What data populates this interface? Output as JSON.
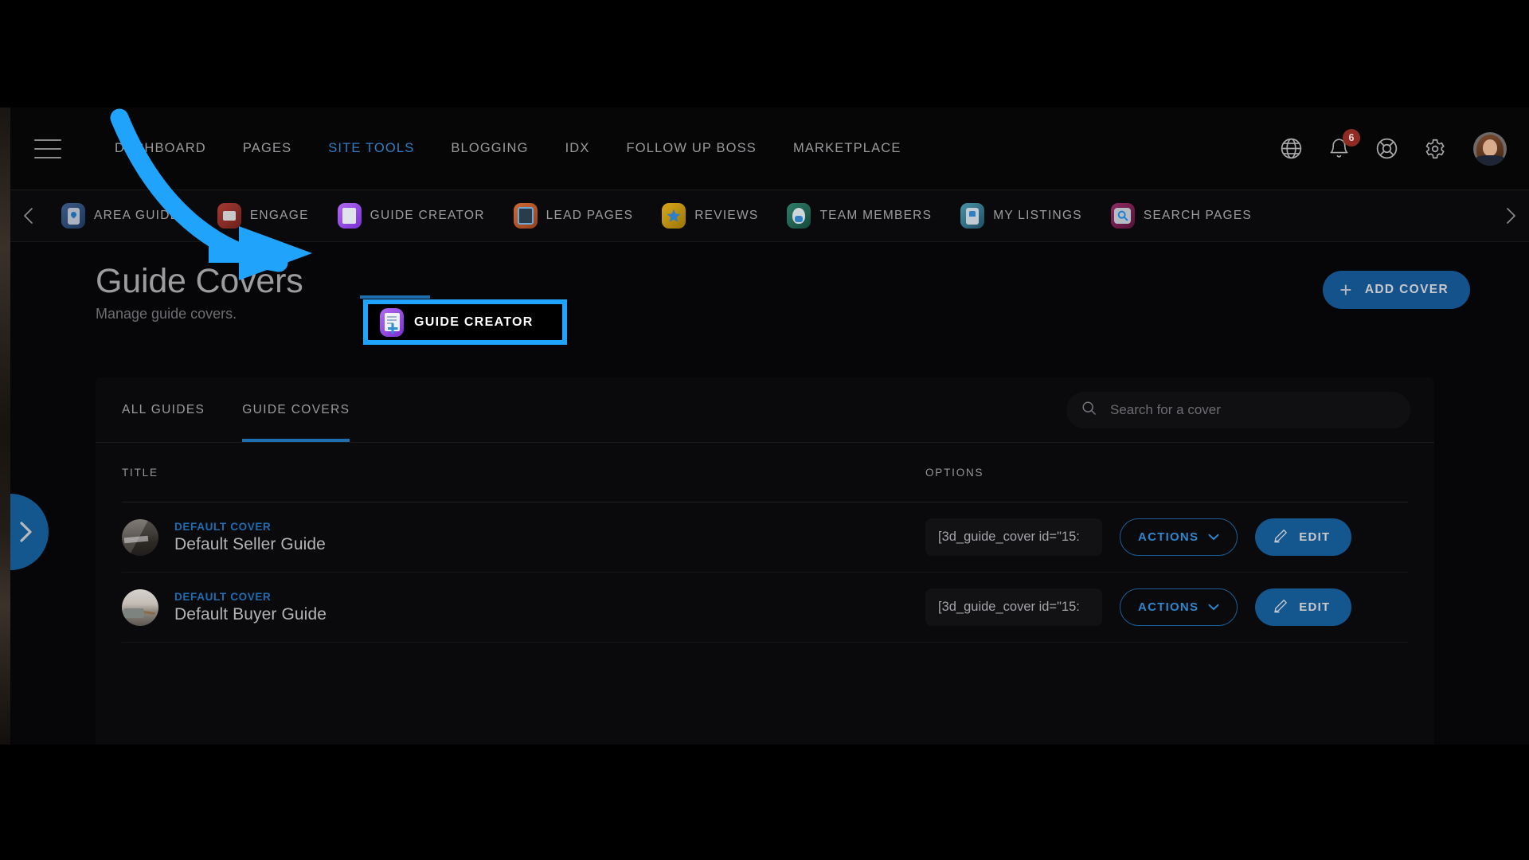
{
  "topnav": {
    "menu_icon": "hamburger-icon",
    "items": [
      {
        "label": "DASHBOARD",
        "active": false
      },
      {
        "label": "PAGES",
        "active": false
      },
      {
        "label": "SITE TOOLS",
        "active": true
      },
      {
        "label": "BLOGGING",
        "active": false
      },
      {
        "label": "IDX",
        "active": false
      },
      {
        "label": "FOLLOW UP BOSS",
        "active": false
      },
      {
        "label": "MARKETPLACE",
        "active": false
      }
    ],
    "icons": [
      {
        "name": "globe-icon"
      },
      {
        "name": "bell-icon",
        "badge": "6"
      },
      {
        "name": "lifebuoy-help-icon"
      },
      {
        "name": "gear-settings-icon"
      },
      {
        "name": "user-avatar"
      }
    ]
  },
  "subnav": {
    "prev_icon": "chevron-left-icon",
    "next_icon": "chevron-right-icon",
    "tabs": [
      {
        "label": "AREA GUIDES",
        "icon": "area-guides-icon",
        "active": false
      },
      {
        "label": "ENGAGE",
        "icon": "engage-icon",
        "active": false
      },
      {
        "label": "GUIDE CREATOR",
        "icon": "guide-creator-icon",
        "active": true
      },
      {
        "label": "LEAD PAGES",
        "icon": "lead-pages-icon",
        "active": false
      },
      {
        "label": "REVIEWS",
        "icon": "reviews-icon",
        "active": false
      },
      {
        "label": "TEAM MEMBERS",
        "icon": "team-members-icon",
        "active": false
      },
      {
        "label": "MY LISTINGS",
        "icon": "my-listings-icon",
        "active": false
      },
      {
        "label": "SEARCH PAGES",
        "icon": "search-pages-icon",
        "active": false
      }
    ]
  },
  "page": {
    "title": "Guide Covers",
    "subtitle": "Manage guide covers.",
    "add_button": "ADD COVER",
    "add_button_icon": "plus-icon"
  },
  "card": {
    "tabs": [
      {
        "label": "ALL GUIDES",
        "active": false
      },
      {
        "label": "GUIDE COVERS",
        "active": true
      }
    ],
    "search": {
      "placeholder": "Search for a cover",
      "value": "",
      "icon": "search-icon"
    },
    "columns": {
      "title": "TITLE",
      "options": "OPTIONS"
    },
    "rows": [
      {
        "badge": "DEFAULT COVER",
        "name": "Default Seller Guide",
        "thumb": "kitchen",
        "shortcode": "[3d_guide_cover id=\"15:",
        "actions_label": "ACTIONS",
        "actions_icon": "chevron-down-icon",
        "edit_label": "EDIT",
        "edit_icon": "pencil-icon"
      },
      {
        "badge": "DEFAULT COVER",
        "name": "Default Buyer Guide",
        "thumb": "living",
        "shortcode": "[3d_guide_cover id=\"15:",
        "actions_label": "ACTIONS",
        "actions_icon": "chevron-down-icon",
        "edit_label": "EDIT",
        "edit_icon": "pencil-icon"
      }
    ]
  },
  "drawer": {
    "handle_icon": "chevron-right-icon"
  },
  "annotation": {
    "arrow_color": "#1fa3fb",
    "highlight_color": "#1fa3fb",
    "target_label": "GUIDE CREATOR"
  },
  "colors": {
    "accent_blue": "#1d6fb0",
    "button_blue": "#14578f",
    "link_blue": "#2f86cc",
    "badge_red": "#8f2b22",
    "page_bg": "#060608",
    "card_bg": "#0a0a0c"
  }
}
